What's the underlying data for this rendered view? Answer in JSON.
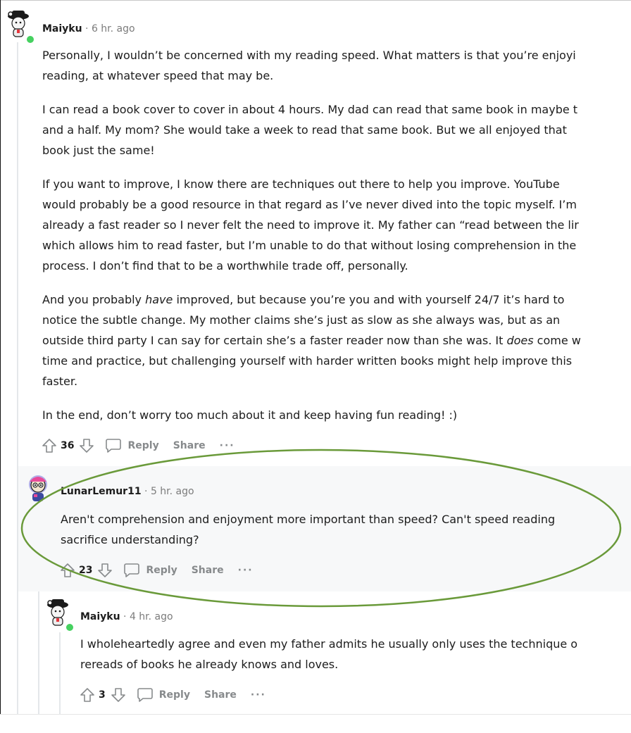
{
  "comments": [
    {
      "user": "Maiyku",
      "sep": "·",
      "time": "6 hr. ago",
      "paragraphs": [
        [
          "Personally, I wouldn’t be concerned with my reading speed. What matters is that you’re enjoyi",
          "reading, at whatever speed that may be."
        ],
        [
          "I can read a book cover to cover in about 4 hours. My dad can read that same book in maybe t",
          "and a half. My mom? She would take a week to read that same book. But we all enjoyed that",
          "book just the same!"
        ],
        [
          "If you want to improve, I know there are techniques out there to help you improve. YouTube",
          "would probably be a good resource in that regard as I’ve never dived into the topic myself. I’m",
          "already a fast reader so I never felt the need to improve it. My father can “read between the lir",
          "which allows him to read faster, but I’m unable to do that without losing comprehension in the",
          "process. I don’t find that to be a worthwhile trade off, personally."
        ],
        [
          "In the end, don’t worry too much about it and keep having fun reading! :)"
        ]
      ],
      "p4": {
        "l1_a": "And you probably ",
        "l1_em": "have",
        "l1_b": " improved, but because you’re you and with yourself 24/7 it’s hard to",
        "l2": "notice the subtle change. My mother claims she’s just as slow as she always was, but as an",
        "l3_a": "outside third party I can say for certain she’s a faster reader now than she was. It ",
        "l3_em": "does",
        "l3_b": " come w",
        "l4": "time and practice, but challenging yourself with harder written books might help improve this",
        "l5": "faster."
      },
      "votes": "36",
      "reply": "Reply",
      "share": "Share",
      "more": "···"
    },
    {
      "user": "LunarLemur11",
      "sep": "·",
      "time": "5 hr. ago",
      "lines": [
        "Aren't comprehension and enjoyment more important than speed? Can't speed reading",
        "sacrifice understanding?"
      ],
      "votes": "23",
      "reply": "Reply",
      "share": "Share",
      "more": "···"
    },
    {
      "user": "Maiyku",
      "sep": "·",
      "time": "4 hr. ago",
      "lines": [
        "I wholeheartedly agree and even my father admits he usually only uses the technique o",
        "rereads of books he already knows and loves."
      ],
      "votes": "3",
      "reply": "Reply",
      "share": "Share",
      "more": "···"
    }
  ],
  "colors": {
    "annotation_ellipse": "#6a9a3a",
    "online_dot": "#46d160",
    "meta_gray": "#7c7c7c",
    "action_gray": "#878a8c"
  },
  "icons": [
    "upvote-icon",
    "downvote-icon",
    "comment-bubble-icon",
    "more-dots-icon"
  ]
}
